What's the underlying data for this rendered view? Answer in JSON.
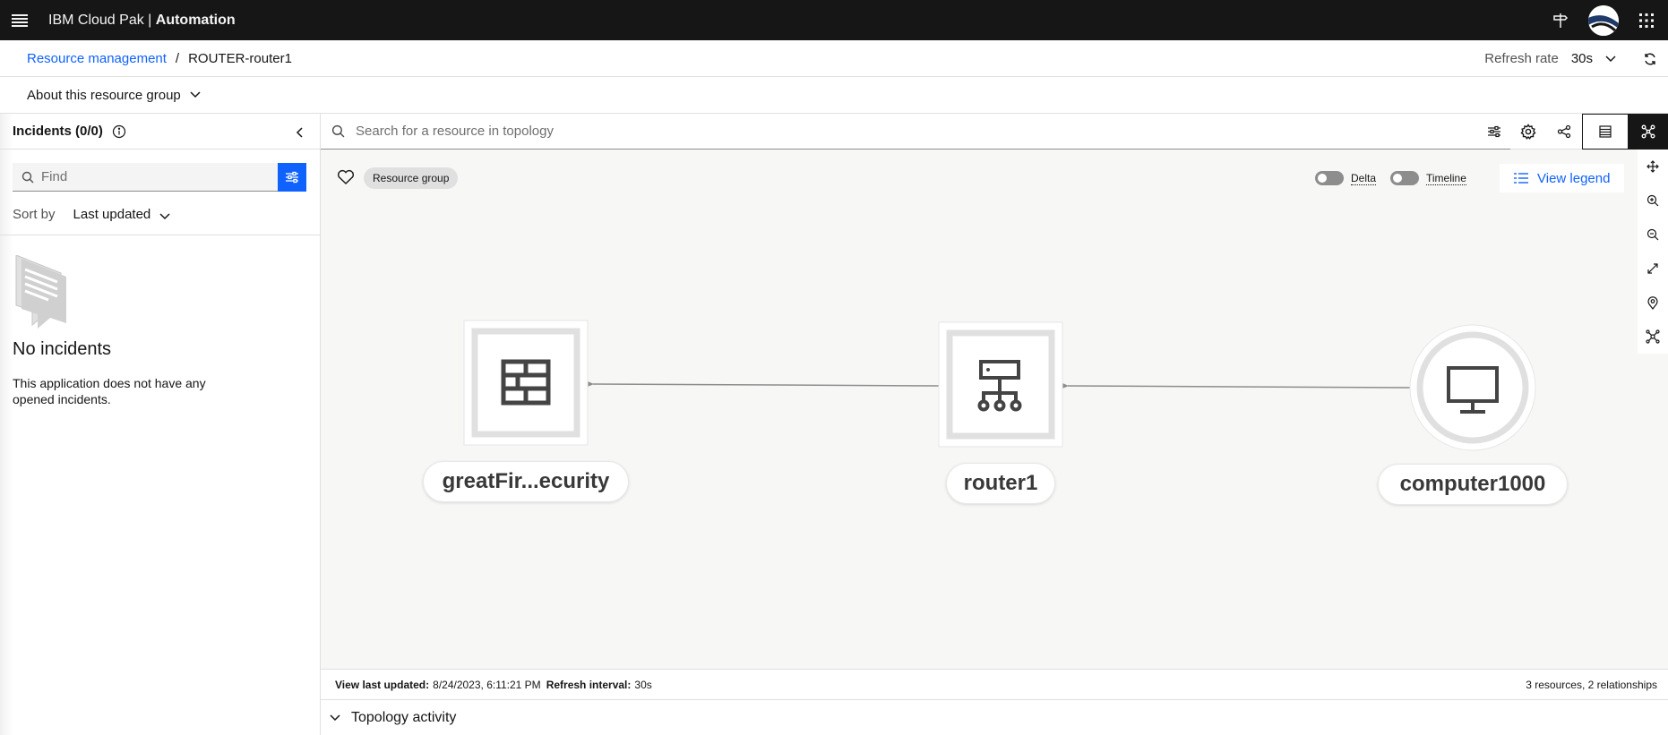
{
  "header": {
    "brand_prefix": "IBM Cloud Pak | ",
    "brand_product": "Automation"
  },
  "breadcrumb": {
    "parent": "Resource management",
    "separator": "/",
    "current": "ROUTER-router1"
  },
  "refresh": {
    "label": "Refresh rate",
    "value": "30s"
  },
  "about": {
    "label": "About this resource group"
  },
  "incidents": {
    "title": "Incidents (0/0)",
    "find_placeholder": "Find",
    "sort_label": "Sort by",
    "sort_value": "Last updated",
    "empty_title": "No incidents",
    "empty_text": "This application does not have any opened incidents."
  },
  "topology": {
    "search_placeholder": "Search for a resource in topology",
    "tag": "Resource group",
    "delta_label": "Delta",
    "timeline_label": "Timeline",
    "legend_label": "View legend",
    "nodes": [
      {
        "id": "firewall",
        "label": "greatFir...ecurity",
        "icon": "firewall-icon",
        "shape": "square"
      },
      {
        "id": "router",
        "label": "router1",
        "icon": "router-icon",
        "shape": "square"
      },
      {
        "id": "computer",
        "label": "computer1000",
        "icon": "monitor-icon",
        "shape": "circle"
      }
    ],
    "edges": [
      {
        "from": "router",
        "to": "firewall"
      },
      {
        "from": "computer",
        "to": "router"
      }
    ]
  },
  "status": {
    "last_updated_label": "View last updated:",
    "last_updated_value": "8/24/2023, 6:11:21 PM",
    "interval_label": "Refresh interval:",
    "interval_value": "30s",
    "summary": "3 resources, 2 relationships"
  },
  "activity": {
    "label": "Topology activity"
  },
  "colors": {
    "header_bg": "#161616",
    "link": "#0f62fe",
    "canvas_bg": "#f7f7f6"
  }
}
